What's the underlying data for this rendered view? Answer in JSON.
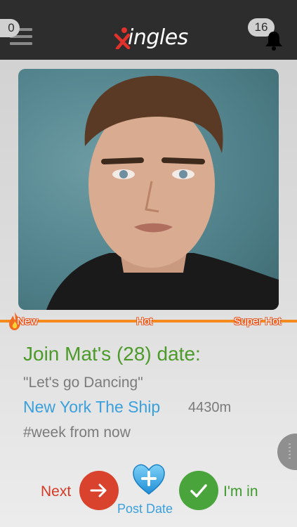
{
  "header": {
    "menu_badge": "0",
    "logo_text": "ingles",
    "notification_count": "16"
  },
  "profile": {
    "photo_icon": "profile-photo",
    "title": "Join Mat's (28) date:",
    "quote": "\"Let's go Dancing\"",
    "venue": "New York The Ship",
    "distance": "4430m",
    "when": "#week from now"
  },
  "heat_meter": {
    "labels": [
      "New",
      "Hot",
      "Super Hot"
    ],
    "bar_color": "#f58a1f"
  },
  "actions": {
    "next_label": "Next",
    "post_label": "Post Date",
    "in_label": "I'm in"
  },
  "colors": {
    "topbar": "#2d2d2d",
    "title_green": "#4c9a2a",
    "link_blue": "#3aa0dd",
    "next_red": "#d9432d",
    "in_green": "#49a43b"
  }
}
